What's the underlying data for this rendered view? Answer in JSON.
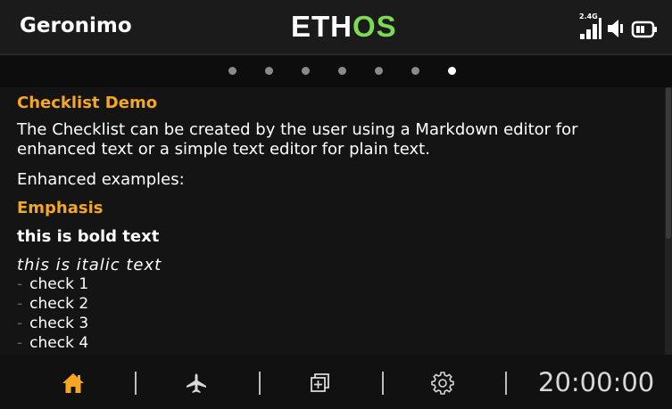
{
  "header": {
    "model_name": "Geronimo",
    "brand_main": "ETH",
    "brand_accent": "OS",
    "rssi_band": "2.4G",
    "icons": [
      "signal-strength-icon",
      "speaker-icon",
      "battery-icon"
    ]
  },
  "pager": {
    "page_count": 7,
    "active_page": 7
  },
  "document": {
    "title": "Checklist Demo",
    "intro_line1": "The Checklist can be created by the user using a Markdown editor for",
    "intro_line2": "enhanced text or a simple text editor for plain text.",
    "examples_label": "Enhanced examples:",
    "emphasis_heading": "Emphasis",
    "bold_example": "this is bold text",
    "italic_example": "this is italic text",
    "checks": [
      "check 1",
      "check 2",
      "check 3",
      "check 4"
    ]
  },
  "footer": {
    "nav_icons": [
      "home-icon",
      "airplane-icon",
      "system-icon",
      "settings-icon"
    ],
    "clock": "20:00:00"
  },
  "colors": {
    "accent_orange": "#f5a623",
    "brand_green": "#7ed957"
  }
}
